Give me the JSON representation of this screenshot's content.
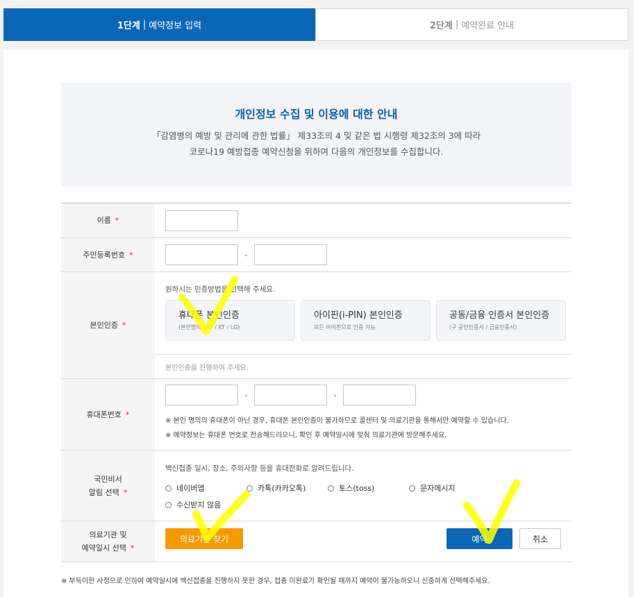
{
  "steps": [
    {
      "num": "1단계",
      "label": "예약정보 입력"
    },
    {
      "num": "2단계",
      "label": "예약완료 안내"
    }
  ],
  "step_separator": "|",
  "notice": {
    "title": "개인정보 수집 및 이용에 대한 안내",
    "line1": "「감염병의 예방 및 관리에 관한 법률」 제33조의 4 및 같은 법 시행령 제32조의 3에 따라",
    "line2": "코로나19 예방접종 예약신청을 위하여 다음의 개인정보를 수집합니다."
  },
  "required_mark": "*",
  "dash": "-",
  "form": {
    "name": {
      "label": "이름"
    },
    "rrn": {
      "label": "주민등록번호"
    },
    "auth": {
      "label": "본인인증",
      "guide": "원하시는 인증방법을 선택해 주세요.",
      "cards": [
        {
          "title": "휴대폰 본인인증",
          "sub": "(본인명의 SKT / KT / LG)"
        },
        {
          "title": "아이핀(i-PIN) 본인인증",
          "sub": "모든 아이핀으로 인증 가능"
        },
        {
          "title": "공동/금융 인증서 본인인증",
          "sub": "(구 공인인증서 / 금융인증서)"
        }
      ],
      "status": "본인인증을 진행하여 주세요."
    },
    "phone": {
      "label": "휴대폰번호",
      "note1": "※ 본인 명의의 휴대폰이 아닌 경우, 휴대폰 본인인증이 불가하므로 콜센터 및 의료기관을 통해서만 예약할 수 있습니다.",
      "note2": "※ 예약정보는 휴대폰 번호로 전송해드리오니, 확인 후 예약일시에 맞춰 의료기관에 방문해주세요."
    },
    "secretary": {
      "label_line1": "국민비서",
      "label_line2": "알림 선택",
      "guide": "백신접종 일시, 장소, 주의사항 등을 휴대전화로 알려드립니다.",
      "options": [
        "네이버앱",
        "카톡(카카오톡)",
        "토스(toss)",
        "문자메시지",
        "수신받지 않음"
      ]
    },
    "clinic": {
      "label_line1": "의료기관 및",
      "label_line2": "예약일시 선택",
      "find_button": "의료기관 찾기",
      "reserve_button": "예약",
      "cancel_button": "취소"
    }
  },
  "footnote": "※ 부득이한 사정으로 인하여 예약일시에 백신접종을 진행하지 못한 경우, 접종 미완료가 확인될 때까지 예약이 불가능하오니 신중하게 선택해주세요.",
  "colors": {
    "primary": "#0a67b5",
    "accent": "#f59a00",
    "required": "#d9262b",
    "highlight": "#ffff00"
  }
}
